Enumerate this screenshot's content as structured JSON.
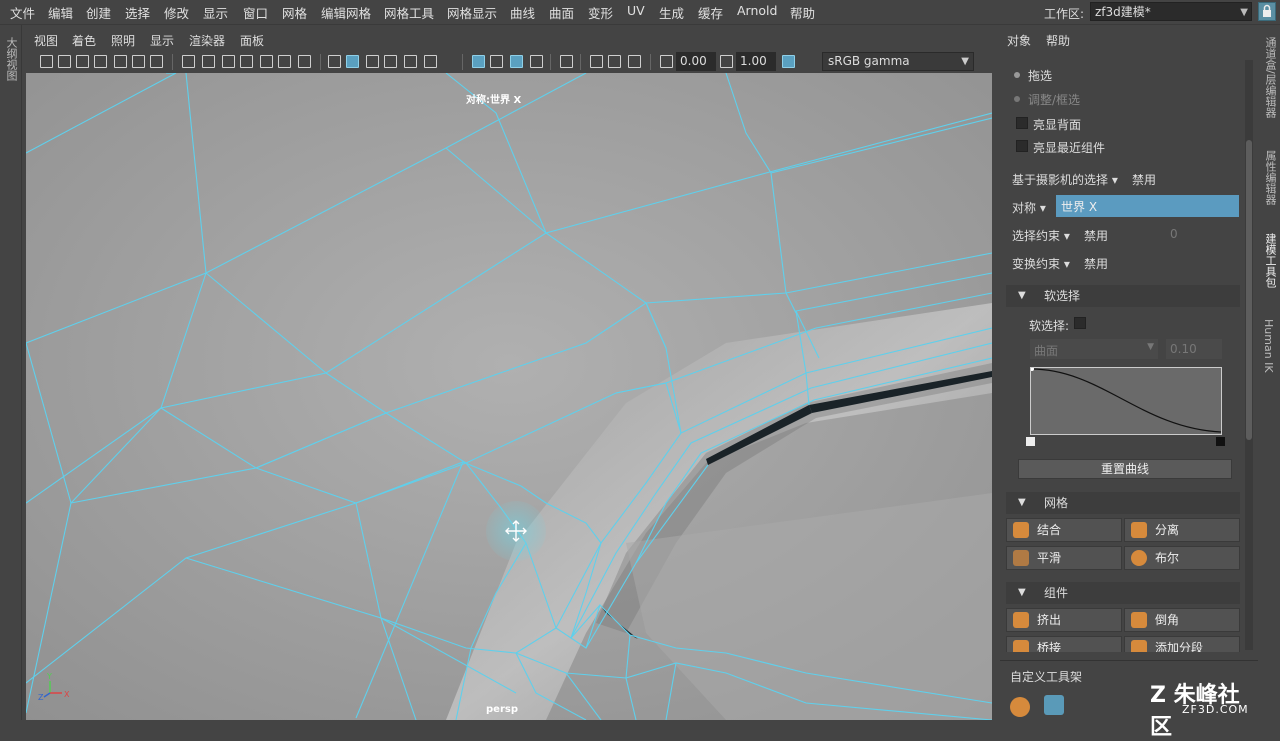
{
  "menubar": {
    "items": [
      "文件",
      "编辑",
      "创建",
      "选择",
      "修改",
      "显示",
      "窗口",
      "网格",
      "编辑网格",
      "网格工具",
      "网格显示",
      "曲线",
      "曲面",
      "变形",
      "UV",
      "生成",
      "缓存",
      "Arnold",
      "帮助"
    ],
    "workspace_label": "工作区:",
    "workspace_value": "zf3d建模*"
  },
  "left_strip": {
    "label": "大纲视图"
  },
  "panel_menu": {
    "items": [
      "视图",
      "着色",
      "照明",
      "显示",
      "渲染器",
      "面板"
    ]
  },
  "toolbar": {
    "field1": "0.00",
    "field2": "1.00",
    "color_space": "sRGB gamma"
  },
  "viewport": {
    "symmetry_label": "对称:世界 X",
    "camera_label": "persp",
    "mesh_color": "#5fd0ec",
    "axis_labels": [
      "Y",
      "Z",
      "X"
    ]
  },
  "right_panel": {
    "menus": [
      "对象",
      "帮助"
    ],
    "options": [
      "拖选",
      "调整/框选"
    ],
    "checks": [
      "亮显背面",
      "亮显最近组件"
    ],
    "camera_select_label": "基于摄影机的选择",
    "camera_select_value": "禁用",
    "symmetry_label": "对称",
    "symmetry_value": "世界 X",
    "select_constraint_label": "选择约束",
    "select_constraint_value": "禁用",
    "select_constraint_num": "0",
    "transform_constraint_label": "变换约束",
    "transform_constraint_value": "禁用",
    "soft_select_header": "软选择",
    "soft_select_label": "软选择:",
    "falloff_mode": "曲面",
    "falloff_value": "0.10",
    "reset_curve": "重置曲线",
    "mesh_header": "网格",
    "mesh_tools": [
      "结合",
      "分离",
      "平滑",
      "布尔"
    ],
    "component_header": "组件",
    "component_tools": [
      "挤出",
      "倒角",
      "桥接",
      "添加分段"
    ],
    "custom_shelf": "自定义工具架"
  },
  "right_tabs": [
    "通道盒/层编辑器",
    "属性编辑器",
    "建模工具包",
    "Human IK"
  ],
  "watermark": {
    "brand": "朱峰社区",
    "url": "ZF3D.COM"
  }
}
